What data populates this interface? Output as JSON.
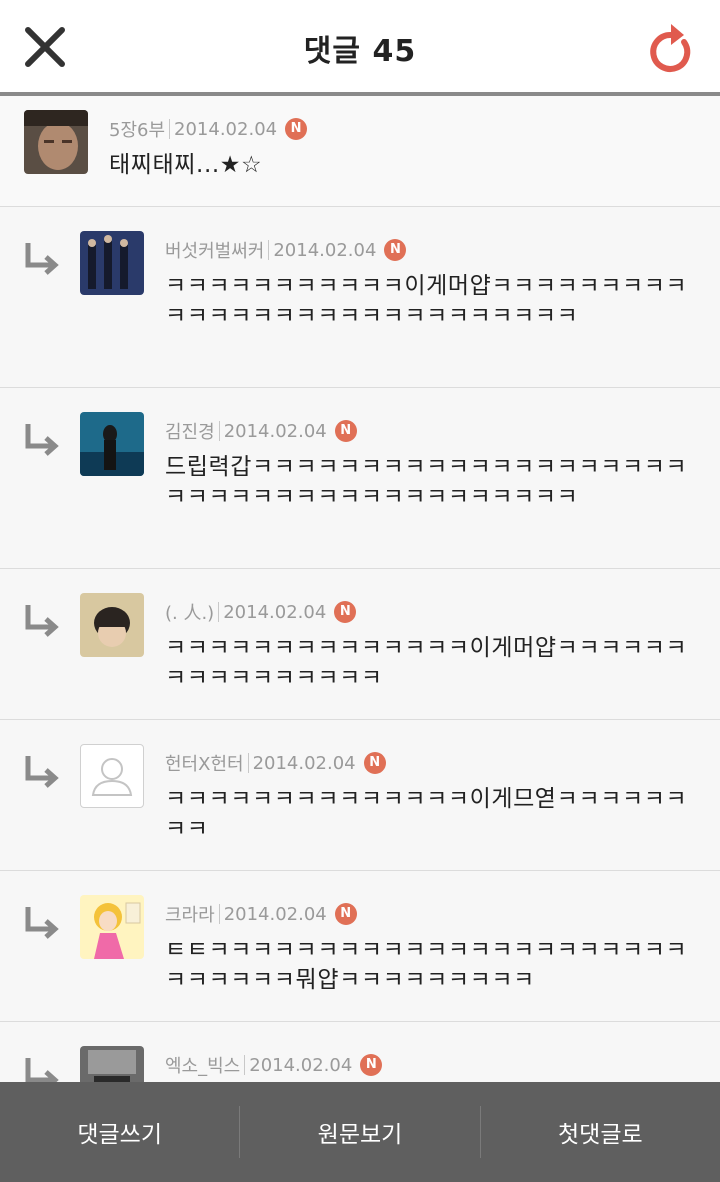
{
  "header": {
    "title": "댓글 45"
  },
  "comments": [
    {
      "author": "5장6부",
      "date": "2014.02.04",
      "badge": "N",
      "text": "태찌태찌...★☆"
    },
    {
      "author": "버섯커벌써커",
      "date": "2014.02.04",
      "badge": "N",
      "text": "ㅋㅋㅋㅋㅋㅋㅋㅋㅋㅋㅋ이게머얍ㅋㅋㅋㅋㅋㅋㅋㅋㅋㅋㅋㅋㅋㅋㅋㅋㅋㅋㅋㅋㅋㅋㅋㅋㅋㅋㅋㅋ"
    },
    {
      "author": "김진경",
      "date": "2014.02.04",
      "badge": "N",
      "text": "드립력갑ㅋㅋㅋㅋㅋㅋㅋㅋㅋㅋㅋㅋㅋㅋㅋㅋㅋㅋㅋㅋㅋㅋㅋㅋㅋㅋㅋㅋㅋㅋㅋㅋㅋㅋㅋㅋㅋㅋㅋ"
    },
    {
      "author": "(. 人.)",
      "date": "2014.02.04",
      "badge": "N",
      "text": "ㅋㅋㅋㅋㅋㅋㅋㅋㅋㅋㅋㅋㅋㅋ이게머얍ㅋㅋㅋㅋㅋㅋㅋㅋㅋㅋㅋㅋㅋㅋㅋㅋ"
    },
    {
      "author": "헌터X헌터",
      "date": "2014.02.04",
      "badge": "N",
      "text": "ㅋㅋㅋㅋㅋㅋㅋㅋㅋㅋㅋㅋㅋㅋ이게므엳ㅋㅋㅋㅋㅋㅋㅋㅋ"
    },
    {
      "author": "크라라",
      "date": "2014.02.04",
      "badge": "N",
      "text": "ㅌㅌㅋㅋㅋㅋㅋㅋㅋㅋㅋㅋㅋㅋㅋㅋㅋㅋㅋㅋㅋㅋㅋㅋㅋㅋㅋㅋㅋㅋ뭐얍ㅋㅋㅋㅋㅋㅋㅋㅋㅋ"
    },
    {
      "author": "엑소_빅스",
      "date": "2014.02.04",
      "badge": "N",
      "text": ""
    }
  ],
  "footer": {
    "write": "댓글쓰기",
    "original": "원문보기",
    "first": "첫댓글로"
  },
  "colors": {
    "accent": "#e05a4e",
    "badge": "#e07056",
    "footer": "#5f5f5f"
  }
}
